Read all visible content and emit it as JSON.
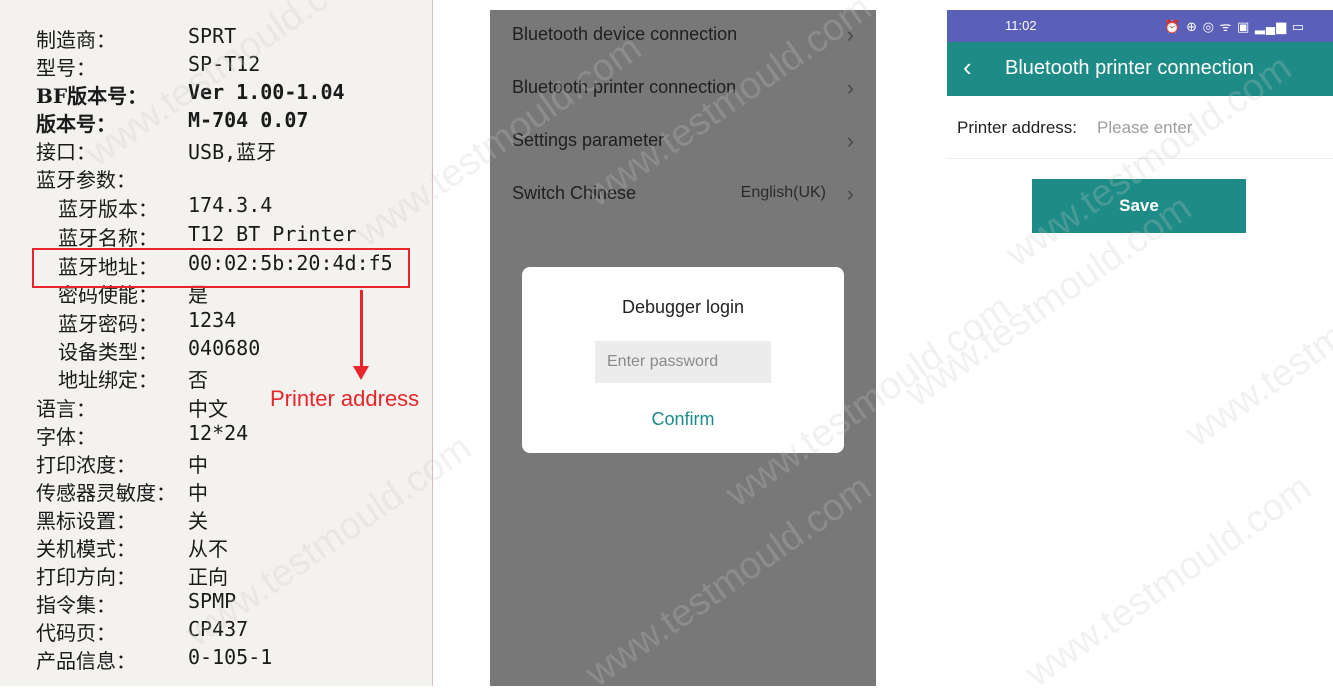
{
  "receipt": {
    "rows": [
      {
        "key": "制造商：",
        "value": "SPRT"
      },
      {
        "key": "型号：",
        "value": "SP-T12"
      },
      {
        "key": "BF版本号：",
        "value": "Ver 1.00-1.04"
      },
      {
        "key": "版本号：",
        "value": "M-704 0.07"
      },
      {
        "key": "接口：",
        "value": "USB,蓝牙"
      },
      {
        "key": "蓝牙参数：",
        "value": ""
      },
      {
        "key": "蓝牙版本：",
        "value": "174.3.4"
      },
      {
        "key": "蓝牙名称：",
        "value": "T12 BT Printer"
      },
      {
        "key": "蓝牙地址：",
        "value": "00:02:5b:20:4d:f5"
      },
      {
        "key": "密码使能：",
        "value": "是"
      },
      {
        "key": "蓝牙密码：",
        "value": "1234"
      },
      {
        "key": "设备类型：",
        "value": "040680"
      },
      {
        "key": "地址绑定：",
        "value": "否"
      },
      {
        "key": "语言：",
        "value": "中文"
      },
      {
        "key": "字体：",
        "value": "12*24"
      },
      {
        "key": "打印浓度：",
        "value": "中"
      },
      {
        "key": "传感器灵敏度：",
        "value": "中"
      },
      {
        "key": "黑标设置：",
        "value": "关"
      },
      {
        "key": "关机模式：",
        "value": "从不"
      },
      {
        "key": "打印方向：",
        "value": "正向"
      },
      {
        "key": "指令集：",
        "value": "SPMP"
      },
      {
        "key": "代码页：",
        "value": "CP437"
      },
      {
        "key": "产品信息：",
        "value": "0-105-1"
      }
    ],
    "callout": "Printer address",
    "accent_color": "#e8252a"
  },
  "settings_menu": {
    "items": [
      {
        "label": "Bluetooth device connection",
        "value": ""
      },
      {
        "label": "Bluetooth printer connection",
        "value": ""
      },
      {
        "label": "Settings parameter",
        "value": ""
      },
      {
        "label": "Switch Chinese",
        "value": "English(UK)"
      }
    ],
    "chevron": "›"
  },
  "dialog": {
    "title": "Debugger login",
    "password_placeholder": "Enter password",
    "confirm_label": "Confirm"
  },
  "printer_screen": {
    "status_time": "11:02",
    "status_icons": "⏰ ⊕ ◎ ᯤ ▣ ▂▄▆ ▭",
    "back_icon": "‹",
    "title": "Bluetooth printer connection",
    "address_label": "Printer address:",
    "address_placeholder": "Please enter",
    "save_label": "Save",
    "theme_color": "#1e8b86",
    "status_bar_color": "#5a5fb8"
  },
  "watermark": "www.testmould.com"
}
